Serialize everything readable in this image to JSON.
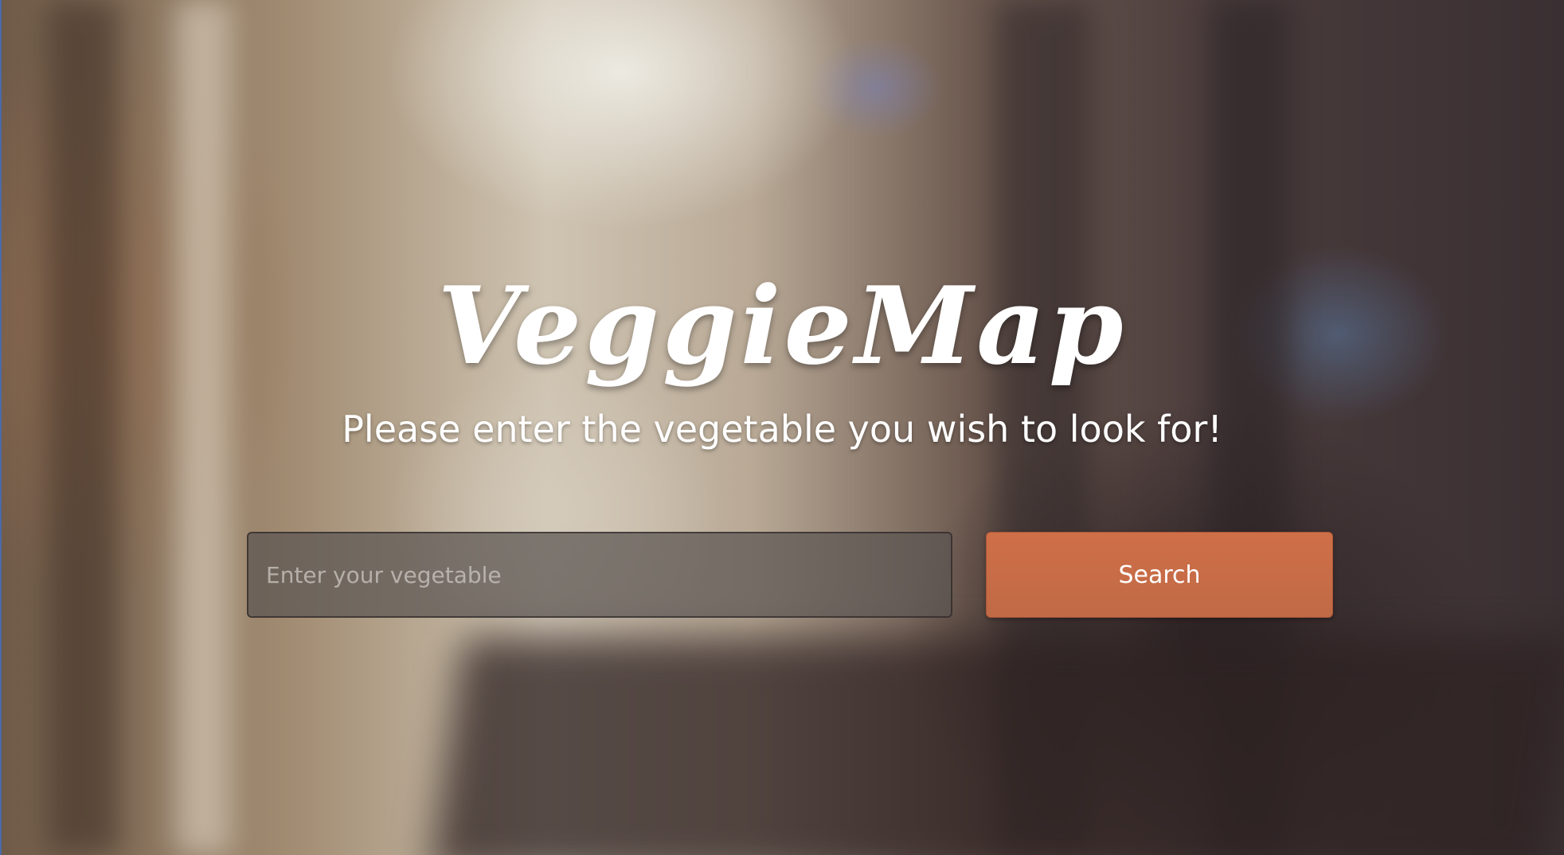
{
  "app": {
    "title": "VeggieMap",
    "tagline": "Please enter the vegetable you wish to look for!"
  },
  "search": {
    "placeholder": "Enter your vegetable",
    "value": "",
    "button_label": "Search"
  },
  "colors": {
    "accent": "#c86a45",
    "text": "#ffffff"
  }
}
